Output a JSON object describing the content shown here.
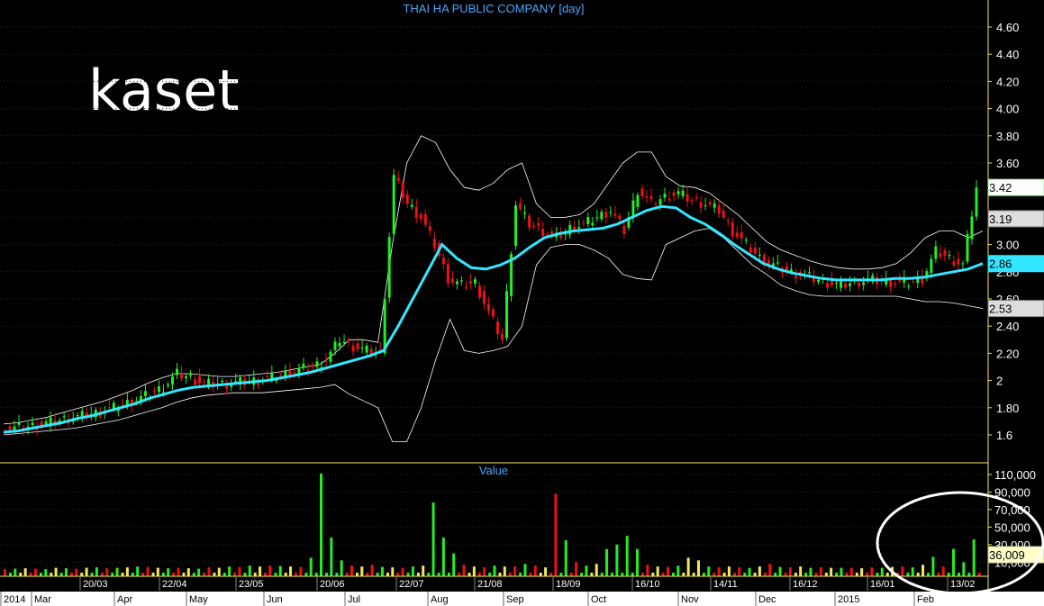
{
  "chart_data": [
    {
      "type": "candlestick",
      "title": "THAI HA PUBLIC COMPANY [day]",
      "watermark": "kaset",
      "ylim": [
        1.5,
        4.75
      ],
      "y_ticks": [
        "1.6",
        "1.80",
        "2",
        "2.20",
        "2.40",
        "2.60",
        "2.80",
        "3.00",
        "3.20",
        "3.40",
        "3.60",
        "3.80",
        "4.00",
        "4.20",
        "4.40",
        "4.60"
      ],
      "y_tick_values": [
        1.6,
        1.8,
        2.0,
        2.2,
        2.4,
        2.6,
        2.8,
        3.0,
        3.2,
        3.4,
        3.6,
        3.8,
        4.0,
        4.2,
        4.4,
        4.6
      ],
      "overlays": [
        "Moving Average",
        "Bollinger Bands"
      ],
      "badges": [
        {
          "text": "3.42",
          "value": 3.42,
          "color": "#ffffff",
          "border": "#88ff88"
        },
        {
          "text": "3.19",
          "value": 3.19,
          "color": "#dddddd",
          "border": "#888888"
        },
        {
          "text": "2.86",
          "value": 2.86,
          "color": "#33e6ff",
          "border": "#33e6ff"
        },
        {
          "text": "2.53",
          "value": 2.53,
          "color": "#dddddd",
          "border": "#888888"
        }
      ],
      "close_series": [
        1.65,
        1.66,
        1.68,
        1.7,
        1.72,
        1.74,
        1.76,
        1.79,
        1.82,
        1.86,
        1.9,
        1.95,
        2.05,
        2.02,
        1.98,
        1.97,
        1.98,
        1.99,
        2.0,
        2.02,
        2.05,
        2.08,
        2.1,
        2.15,
        2.3,
        2.25,
        2.22,
        2.2,
        3.5,
        3.3,
        3.2,
        3.0,
        2.75,
        2.7,
        2.72,
        2.5,
        2.3,
        3.3,
        3.15,
        3.1,
        3.05,
        3.12,
        3.15,
        3.2,
        3.25,
        3.1,
        3.4,
        3.3,
        3.35,
        3.38,
        3.32,
        3.3,
        3.25,
        3.1,
        3.0,
        2.9,
        2.85,
        2.8,
        2.78,
        2.75,
        2.72,
        2.7,
        2.72,
        2.74,
        2.73,
        2.72,
        2.72,
        2.75,
        2.95,
        2.9,
        2.85,
        3.42
      ],
      "ma_series": [
        1.62,
        1.63,
        1.65,
        1.67,
        1.69,
        1.72,
        1.74,
        1.77,
        1.8,
        1.83,
        1.87,
        1.9,
        1.93,
        1.95,
        1.96,
        1.97,
        1.98,
        1.99,
        2.0,
        2.02,
        2.04,
        2.06,
        2.09,
        2.12,
        2.15,
        2.18,
        2.22,
        2.4,
        2.6,
        2.8,
        3.0,
        2.9,
        2.83,
        2.82,
        2.85,
        2.9,
        2.98,
        3.05,
        3.08,
        3.1,
        3.11,
        3.12,
        3.15,
        3.2,
        3.25,
        3.28,
        3.27,
        3.2,
        3.15,
        3.08,
        3.0,
        2.93,
        2.86,
        2.82,
        2.79,
        2.77,
        2.75,
        2.74,
        2.74,
        2.74,
        2.74,
        2.75,
        2.75,
        2.76,
        2.78,
        2.8,
        2.82,
        2.86
      ],
      "upper_band": [
        1.68,
        1.69,
        1.71,
        1.73,
        1.76,
        1.79,
        1.82,
        1.85,
        1.89,
        1.93,
        1.98,
        2.02,
        2.05,
        2.05,
        2.04,
        2.03,
        2.03,
        2.04,
        2.05,
        2.06,
        2.08,
        2.1,
        2.12,
        2.2,
        2.3,
        2.3,
        2.28,
        3.0,
        3.6,
        3.8,
        3.75,
        3.55,
        3.42,
        3.4,
        3.45,
        3.55,
        3.6,
        3.3,
        3.2,
        3.2,
        3.22,
        3.3,
        3.45,
        3.6,
        3.68,
        3.68,
        3.5,
        3.43,
        3.42,
        3.38,
        3.3,
        3.22,
        3.12,
        3.02,
        2.96,
        2.92,
        2.88,
        2.85,
        2.83,
        2.82,
        2.82,
        2.83,
        2.86,
        2.94,
        3.05,
        3.1,
        3.1,
        3.05,
        3.1
      ],
      "lower_band": [
        1.6,
        1.61,
        1.62,
        1.63,
        1.64,
        1.65,
        1.67,
        1.69,
        1.71,
        1.74,
        1.77,
        1.8,
        1.84,
        1.87,
        1.89,
        1.9,
        1.91,
        1.91,
        1.91,
        1.92,
        1.93,
        1.94,
        1.95,
        1.97,
        1.9,
        1.85,
        1.8,
        1.55,
        1.55,
        1.8,
        2.15,
        2.45,
        2.22,
        2.2,
        2.22,
        2.25,
        2.4,
        2.85,
        2.98,
        3.0,
        3.0,
        2.96,
        2.9,
        2.78,
        2.75,
        2.74,
        3.0,
        3.05,
        3.1,
        3.12,
        3.05,
        2.95,
        2.85,
        2.78,
        2.7,
        2.66,
        2.63,
        2.62,
        2.62,
        2.62,
        2.62,
        2.62,
        2.62,
        2.6,
        2.58,
        2.58,
        2.57,
        2.55,
        2.53
      ]
    },
    {
      "type": "bar",
      "title": "Value",
      "ylim": [
        0,
        120000
      ],
      "y_ticks": [
        "10,000",
        "30,000",
        "50,000",
        "70,000",
        "90,000",
        "110,000"
      ],
      "y_tick_values": [
        10000,
        30000,
        50000,
        70000,
        90000,
        110000
      ],
      "last_value_label": "36,009",
      "values": [
        2000,
        2500,
        3000,
        2500,
        2000,
        3500,
        3000,
        2500,
        3500,
        4000,
        3000,
        3500,
        4000,
        5000,
        4500,
        3500,
        3000,
        3500,
        3000,
        2500,
        4000,
        3500,
        5000,
        4500,
        6000,
        5000,
        6000,
        5500,
        5000,
        4500,
        15000,
        115000,
        38000,
        12000,
        6000,
        5000,
        7000,
        4500,
        4000,
        3500,
        5000,
        6000,
        78000,
        38000,
        20000,
        7000,
        5000,
        4000,
        6000,
        5000,
        5000,
        8000,
        6000,
        4000,
        88000,
        35000,
        10000,
        6000,
        8000,
        25000,
        30000,
        40000,
        25000,
        7000,
        5000,
        4500,
        6000,
        15000,
        12000,
        5000,
        4000,
        5000,
        4000,
        3500,
        5000,
        8000,
        4500,
        4000,
        5000,
        3500,
        4000,
        3500,
        3500,
        3500,
        3000,
        4000,
        3500,
        4500,
        5000,
        4000,
        7000,
        16000,
        5000,
        25000,
        10000,
        36009
      ],
      "colors": [
        "r",
        "g",
        "y",
        "r",
        "g",
        "y",
        "g",
        "r",
        "y",
        "g",
        "r",
        "g",
        "y",
        "g",
        "r",
        "y",
        "g",
        "r",
        "y",
        "g",
        "r",
        "y",
        "g",
        "r",
        "g",
        "y",
        "r",
        "g",
        "y",
        "r",
        "g",
        "g",
        "g",
        "g",
        "r",
        "y",
        "r",
        "g",
        "y",
        "r",
        "g",
        "y",
        "g",
        "g",
        "g",
        "r",
        "y",
        "r",
        "g",
        "y",
        "r",
        "g",
        "r",
        "y",
        "r",
        "g",
        "r",
        "g",
        "y",
        "g",
        "g",
        "g",
        "g",
        "r",
        "y",
        "r",
        "g",
        "y",
        "y",
        "g",
        "r",
        "y",
        "r",
        "g",
        "y",
        "r",
        "g",
        "r",
        "y",
        "g",
        "r",
        "y",
        "g",
        "r",
        "y",
        "r",
        "g",
        "y",
        "r",
        "g",
        "y",
        "g",
        "r",
        "g",
        "g",
        "g"
      ]
    }
  ],
  "x_axis": {
    "top_row": [
      "20/03",
      "22/04",
      "23/05",
      "20/06",
      "22/07",
      "21/08",
      "18/09",
      "16/10",
      "14/11",
      "16/12",
      "16/01",
      "13/02"
    ],
    "bottom_row": [
      "2014",
      "Mar",
      "Apr",
      "May",
      "Jun",
      "Jul",
      "Aug",
      "Sep",
      "Oct",
      "Nov",
      "Dec",
      "2015",
      "Feb"
    ]
  },
  "colors": {
    "up": "#22ee22",
    "down": "#ee1111",
    "ma": "#33e6ff",
    "band": "#ffffff",
    "title": "#4da6ff",
    "separator": "#f2e85c",
    "volume_yellow": "#f2e85c",
    "circle": "#ffffff"
  }
}
